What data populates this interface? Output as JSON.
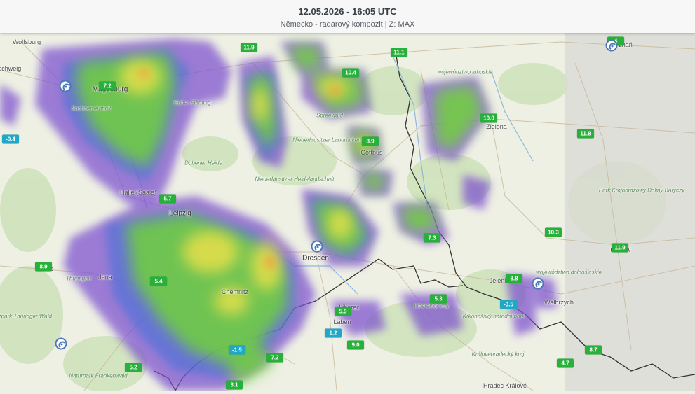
{
  "header": {
    "time": "12.05.2026 - 16:05 UTC",
    "subtitle": "Německo - radarový kompozit | Z: MAX"
  },
  "temperatures": [
    {
      "value": "11.9",
      "kind": "warm"
    },
    {
      "value": "11.1",
      "kind": "warm"
    },
    {
      "value": "10.4",
      "kind": "warm"
    },
    {
      "value": "7.2",
      "kind": "warm"
    },
    {
      "value": "10.0",
      "kind": "warm"
    },
    {
      "value": "-0.4",
      "kind": "cold"
    },
    {
      "value": "8.9",
      "kind": "warm"
    },
    {
      "value": "11.8",
      "kind": "warm"
    },
    {
      "value": "5.7",
      "kind": "warm"
    },
    {
      "value": "7.3",
      "kind": "warm"
    },
    {
      "value": "10.3",
      "kind": "warm"
    },
    {
      "value": "11.9",
      "kind": "warm"
    },
    {
      "value": "8.9",
      "kind": "warm"
    },
    {
      "value": "5.4",
      "kind": "warm"
    },
    {
      "value": "8.8",
      "kind": "warm"
    },
    {
      "value": "5.3",
      "kind": "warm"
    },
    {
      "value": "-3.5",
      "kind": "cold"
    },
    {
      "value": "5.9",
      "kind": "warm"
    },
    {
      "value": "1.2",
      "kind": "cold"
    },
    {
      "value": "9.0",
      "kind": "warm"
    },
    {
      "value": "-1.5",
      "kind": "cold"
    },
    {
      "value": "7.3",
      "kind": "warm"
    },
    {
      "value": "8.7",
      "kind": "warm"
    },
    {
      "value": "5.2",
      "kind": "warm"
    },
    {
      "value": "4.7",
      "kind": "warm"
    },
    {
      "value": "3.1",
      "kind": "warm"
    },
    {
      "value": "4",
      "kind": "warm"
    }
  ],
  "places": [
    {
      "name": "Wolfsburg",
      "kind": "city"
    },
    {
      "name": "schweig",
      "kind": "city"
    },
    {
      "name": "Magdeburg",
      "kind": "big"
    },
    {
      "name": "Halle (Saale)",
      "kind": "city"
    },
    {
      "name": "Leipzig",
      "kind": "big"
    },
    {
      "name": "Dresden",
      "kind": "big"
    },
    {
      "name": "Jena",
      "kind": "city"
    },
    {
      "name": "Chemnitz",
      "kind": "city"
    },
    {
      "name": "Jelenia",
      "kind": "city"
    },
    {
      "name": "Wałbrzych",
      "kind": "city"
    },
    {
      "name": "Zielona",
      "kind": "city"
    },
    {
      "name": "Cottbus",
      "kind": "city"
    },
    {
      "name": "znań",
      "kind": "city"
    },
    {
      "name": "rocław",
      "kind": "big"
    },
    {
      "name": "Liberec",
      "kind": "city"
    },
    {
      "name": "Hradec Králové",
      "kind": "city"
    },
    {
      "name": "Niederlausitzer Landrücken",
      "kind": "park"
    },
    {
      "name": "Niederlausitzer Heidelandschaft",
      "kind": "park"
    },
    {
      "name": "Dübener Heide",
      "kind": "park"
    },
    {
      "name": "Hoher Fläming",
      "kind": "park"
    },
    {
      "name": "Naturpark Thüringer Wald",
      "kind": "park"
    },
    {
      "name": "Naturpark Frankenwald",
      "kind": "park"
    },
    {
      "name": "Park Krajobrazowy Doliny Baryczy",
      "kind": "park"
    },
    {
      "name": "województwo lubuskie",
      "kind": "park"
    },
    {
      "name": "województwo dolnośląskie",
      "kind": "park"
    },
    {
      "name": "Krkonošský národní park",
      "kind": "park"
    },
    {
      "name": "Královéhradecký kraj",
      "kind": "park"
    },
    {
      "name": "Thüringen",
      "kind": "park"
    },
    {
      "name": "Sachsen-Anhalt",
      "kind": "park"
    },
    {
      "name": "Spreewald",
      "kind": "park"
    },
    {
      "name": "Liberecký kraj",
      "kind": "park"
    },
    {
      "name": "Laben",
      "kind": "city"
    },
    {
      "name": "art",
      "kind": "city"
    }
  ],
  "stations": [
    {
      "name": "radar-station"
    },
    {
      "name": "radar-station"
    },
    {
      "name": "radar-station"
    },
    {
      "name": "radar-station"
    },
    {
      "name": "radar-station"
    }
  ]
}
